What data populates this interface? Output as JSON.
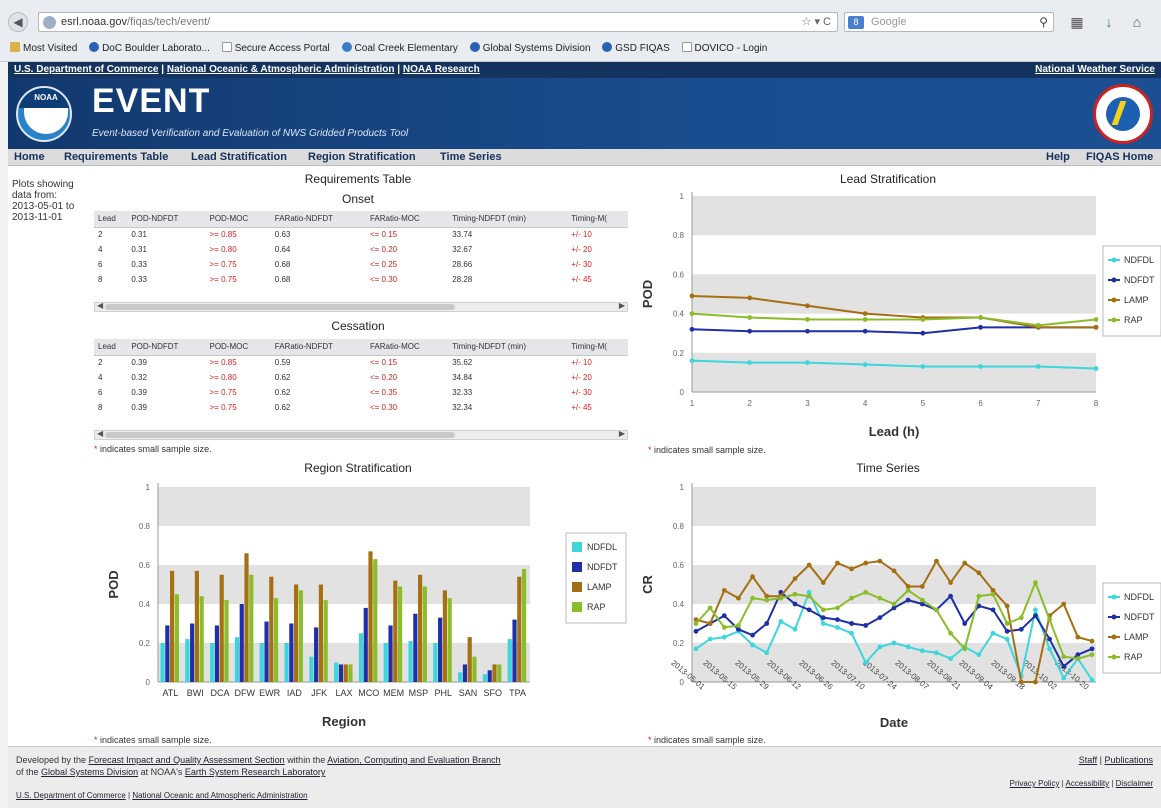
{
  "browser": {
    "url_host": "esrl.noaa.gov",
    "url_path": "/fiqas/tech/event/",
    "search_engine": "Google",
    "bookmarks": [
      "Most Visited",
      "DoC Boulder Laborato...",
      "Secure Access Portal",
      "Coal Creek Elementary",
      "Global Systems Division",
      "GSD FIQAS",
      "DOVICO - Login"
    ]
  },
  "header": {
    "doc_links": [
      "U.S. Department of Commerce",
      "National Oceanic & Atmospheric Administration",
      "NOAA Research"
    ],
    "nws_link": "National Weather Service",
    "logo_text": "NOAA",
    "title": "EVENT",
    "subtitle": "Event-based Verification and Evaluation of NWS Gridded Products Tool"
  },
  "menu": {
    "left": [
      "Home",
      "Requirements Table",
      "Lead Stratification",
      "Region Stratification",
      "Time Series"
    ],
    "right": [
      "Help",
      "FIQAS Home"
    ]
  },
  "side_note": "Plots showing data from: 2013-05-01 to 2013-11-01",
  "requirements": {
    "title": "Requirements Table",
    "onset_title": "Onset",
    "cessation_title": "Cessation",
    "onset_headers": [
      "Lead",
      "POD-NDFDT",
      "POD-MOC",
      "FARatio-NDFDT",
      "FARatio-MOC",
      "Timing-NDFDT (min)",
      "Timing-M("
    ],
    "onset_rows": [
      [
        "2",
        "0.31",
        ">= 0.85",
        "0.63",
        "<= 0.15",
        "33.74",
        "+/- 10"
      ],
      [
        "4",
        "0.31",
        ">= 0.80",
        "0.64",
        "<= 0.20",
        "32.67",
        "+/- 20"
      ],
      [
        "6",
        "0.33",
        ">= 0.75",
        "0.68",
        "<= 0.25",
        "28.66",
        "+/- 30"
      ],
      [
        "8",
        "0.33",
        ">= 0.75",
        "0.68",
        "<= 0.30",
        "28.28",
        "+/- 45"
      ]
    ],
    "cessation_headers": [
      "Lead",
      "POD-NDFDT",
      "POD-MOC",
      "FARatio-NDFDT",
      "FARatio-MOC",
      "Timing-NDFDT (min)",
      "Timing-M("
    ],
    "cessation_rows": [
      [
        "2",
        "0.39",
        ">= 0.85",
        "0.59",
        "<= 0.15",
        "35.62",
        "+/- 10"
      ],
      [
        "4",
        "0.32",
        ">= 0.80",
        "0.62",
        "<= 0.20",
        "34.84",
        "+/- 20"
      ],
      [
        "6",
        "0.39",
        ">= 0.75",
        "0.62",
        "<= 0.35",
        "32.33",
        "+/- 30"
      ],
      [
        "8",
        "0.39",
        ">= 0.75",
        "0.62",
        "<= 0.30",
        "32.34",
        "+/- 45"
      ]
    ],
    "scroll_thumb": "III"
  },
  "notes": {
    "small_sample": "indicates small sample size.",
    "star": "*"
  },
  "colors": {
    "NDFDL": "#3cd6dc",
    "NDFDT": "#1f2fa8",
    "LAMP": "#a66f12",
    "RAP": "#8bbd2a",
    "band": "#e2e2e2"
  },
  "chart_data": [
    {
      "type": "line",
      "title": "Lead Stratification",
      "xlabel": "Lead (h)",
      "ylabel": "POD",
      "x": [
        1,
        2,
        3,
        4,
        5,
        6,
        7,
        8
      ],
      "ylim": [
        0,
        1
      ],
      "yticks": [
        "0",
        "0.2",
        "0.4",
        "0.6",
        "0.8",
        "1"
      ],
      "legend_position": "right",
      "series": [
        {
          "name": "NDFDL",
          "values": [
            0.16,
            0.15,
            0.15,
            0.14,
            0.13,
            0.13,
            0.13,
            0.12
          ]
        },
        {
          "name": "NDFDT",
          "values": [
            0.32,
            0.31,
            0.31,
            0.31,
            0.3,
            0.33,
            0.33,
            0.33
          ]
        },
        {
          "name": "LAMP",
          "values": [
            0.49,
            0.48,
            0.44,
            0.4,
            0.38,
            0.38,
            0.33,
            0.33
          ]
        },
        {
          "name": "RAP",
          "values": [
            0.4,
            0.38,
            0.37,
            0.37,
            0.37,
            0.38,
            0.34,
            0.37
          ]
        }
      ]
    },
    {
      "type": "bar",
      "title": "Region Stratification",
      "xlabel": "Region",
      "ylabel": "POD",
      "ylim": [
        0,
        1
      ],
      "yticks": [
        "0",
        "0.2",
        "0.4",
        "0.6",
        "0.8",
        "1"
      ],
      "legend_position": "right",
      "categories": [
        "ATL",
        "BWI",
        "DCA",
        "DFW",
        "EWR",
        "IAD",
        "JFK",
        "LAX",
        "MCO",
        "MEM",
        "MSP",
        "PHL",
        "SAN",
        "SFO",
        "TPA"
      ],
      "category_labels_shown": [
        "ATL",
        "BWI",
        "DCA",
        "DFW",
        "EWR",
        "IAD",
        "JFK",
        "LAX",
        "MCO",
        "MEM",
        "MSP",
        "PHL",
        "SAN",
        "SFO",
        "TPA"
      ],
      "series": [
        {
          "name": "NDFDL",
          "values": [
            0.2,
            0.22,
            0.2,
            0.23,
            0.2,
            0.2,
            0.13,
            0.1,
            0.25,
            0.2,
            0.21,
            0.2,
            0.05,
            0.04,
            0.22
          ]
        },
        {
          "name": "NDFDT",
          "values": [
            0.29,
            0.3,
            0.29,
            0.4,
            0.31,
            0.3,
            0.28,
            0.09,
            0.38,
            0.29,
            0.35,
            0.33,
            0.09,
            0.06,
            0.32
          ]
        },
        {
          "name": "LAMP",
          "values": [
            0.57,
            0.57,
            0.55,
            0.66,
            0.54,
            0.5,
            0.5,
            0.09,
            0.67,
            0.52,
            0.55,
            0.47,
            0.23,
            0.09,
            0.54
          ]
        },
        {
          "name": "RAP",
          "values": [
            0.45,
            0.44,
            0.42,
            0.55,
            0.43,
            0.47,
            0.42,
            0.09,
            0.63,
            0.49,
            0.49,
            0.43,
            0.13,
            0.09,
            0.58
          ]
        }
      ]
    },
    {
      "type": "line",
      "title": "Time Series",
      "xlabel": "Date",
      "ylabel": "CR",
      "ylim": [
        0,
        1
      ],
      "yticks": [
        "0",
        "0.2",
        "0.4",
        "0.6",
        "0.8",
        "1"
      ],
      "legend_position": "right",
      "xtick_labels": [
        "2013-05-01",
        "2013-05-15",
        "2013-05-29",
        "2013-06-12",
        "2013-06-26",
        "2013-07-10",
        "2013-07-24",
        "2013-08-07",
        "2013-08-21",
        "2013-09-04",
        "2013-09-18",
        "2013-10-02",
        "2013-10-20"
      ],
      "series": [
        {
          "name": "NDFDL",
          "values": [
            0.17,
            0.22,
            0.23,
            0.26,
            0.19,
            0.15,
            0.31,
            0.27,
            0.46,
            0.3,
            0.28,
            0.25,
            0.1,
            0.18,
            0.2,
            0.18,
            0.16,
            0.15,
            0.12,
            0.18,
            0.14,
            0.25,
            0.22,
            0.03,
            0.37,
            0.17,
            0.02,
            0.12,
            0.01
          ]
        },
        {
          "name": "NDFDT",
          "values": [
            0.26,
            0.3,
            0.34,
            0.27,
            0.24,
            0.3,
            0.46,
            0.4,
            0.37,
            0.33,
            0.32,
            0.3,
            0.29,
            0.33,
            0.38,
            0.42,
            0.4,
            0.37,
            0.44,
            0.3,
            0.39,
            0.37,
            0.26,
            0.27,
            0.34,
            0.22,
            0.08,
            0.14,
            0.17
          ]
        },
        {
          "name": "LAMP",
          "values": [
            0.32,
            0.3,
            0.47,
            0.43,
            0.54,
            0.44,
            0.44,
            0.53,
            0.6,
            0.51,
            0.61,
            0.58,
            0.61,
            0.62,
            0.57,
            0.49,
            0.49,
            0.62,
            0.51,
            0.61,
            0.56,
            0.47,
            0.39,
            0.0,
            0.0,
            0.34,
            0.4,
            0.23,
            0.21
          ]
        },
        {
          "name": "RAP",
          "values": [
            0.3,
            0.38,
            0.28,
            0.29,
            0.43,
            0.42,
            0.43,
            0.45,
            0.44,
            0.37,
            0.38,
            0.43,
            0.46,
            0.43,
            0.4,
            0.47,
            0.42,
            0.37,
            0.25,
            0.17,
            0.44,
            0.45,
            0.3,
            0.33,
            0.51,
            0.32,
            0.13,
            0.12,
            0.14
          ]
        }
      ]
    }
  ],
  "footer": {
    "l1_pre": "Developed by the",
    "l1_link1": "Forecast Impact and Quality Assessment Section",
    "l1_mid": "within the",
    "l1_link2": "Aviation, Computing and Evaluation Branch",
    "l2_pre": "of the",
    "l2_link1": "Global Systems Division",
    "l2_mid": "at NOAA's",
    "l2_link2": "Earth System Research Laboratory",
    "l3_link1": "U.S. Department of Commerce",
    "l3_link2": "National Oceanic and Atmospheric Administration",
    "staff": "Staff",
    "publications": "Publications",
    "privacy": "Privacy Policy",
    "accessibility": "Accessibility",
    "disclaimer": "Disclaimer"
  }
}
